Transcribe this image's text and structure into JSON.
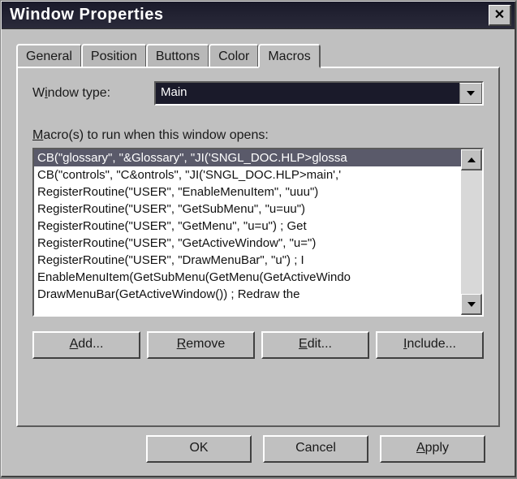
{
  "window": {
    "title": "Window Properties"
  },
  "tabs": [
    "General",
    "Position",
    "Buttons",
    "Color",
    "Macros"
  ],
  "active_tab_index": 4,
  "window_type": {
    "label_pre": "W",
    "label_u": "i",
    "label_post": "ndow type:",
    "value": "Main"
  },
  "macros_label": {
    "pre": "",
    "u": "M",
    "post": "acro(s) to run when this window opens:"
  },
  "macros": [
    "CB(\"glossary\", \"&Glossary\", \"JI('SNGL_DOC.HLP>glossa",
    "CB(\"controls\", \"C&ontrols\", \"JI('SNGL_DOC.HLP>main','",
    "RegisterRoutine(\"USER\", \"EnableMenuItem\", \"uuu\")",
    "RegisterRoutine(\"USER\", \"GetSubMenu\", \"u=uu\")",
    "RegisterRoutine(\"USER\", \"GetMenu\", \"u=u\")        ; Get",
    "RegisterRoutine(\"USER\", \"GetActiveWindow\", \"u=\")",
    "RegisterRoutine(\"USER\", \"DrawMenuBar\", \"u\")        ; I",
    "EnableMenuItem(GetSubMenu(GetMenu(GetActiveWindo",
    "DrawMenuBar(GetActiveWindow())        ; Redraw the"
  ],
  "selected_macro_index": 0,
  "buttons": {
    "add": {
      "u": "A",
      "post": "dd..."
    },
    "remove": {
      "u": "R",
      "post": "emove"
    },
    "edit": {
      "u": "E",
      "post": "dit..."
    },
    "include": {
      "u": "I",
      "post": "nclude..."
    }
  },
  "footer": {
    "ok": "OK",
    "cancel": "Cancel",
    "apply_u": "A",
    "apply_post": "pply"
  }
}
